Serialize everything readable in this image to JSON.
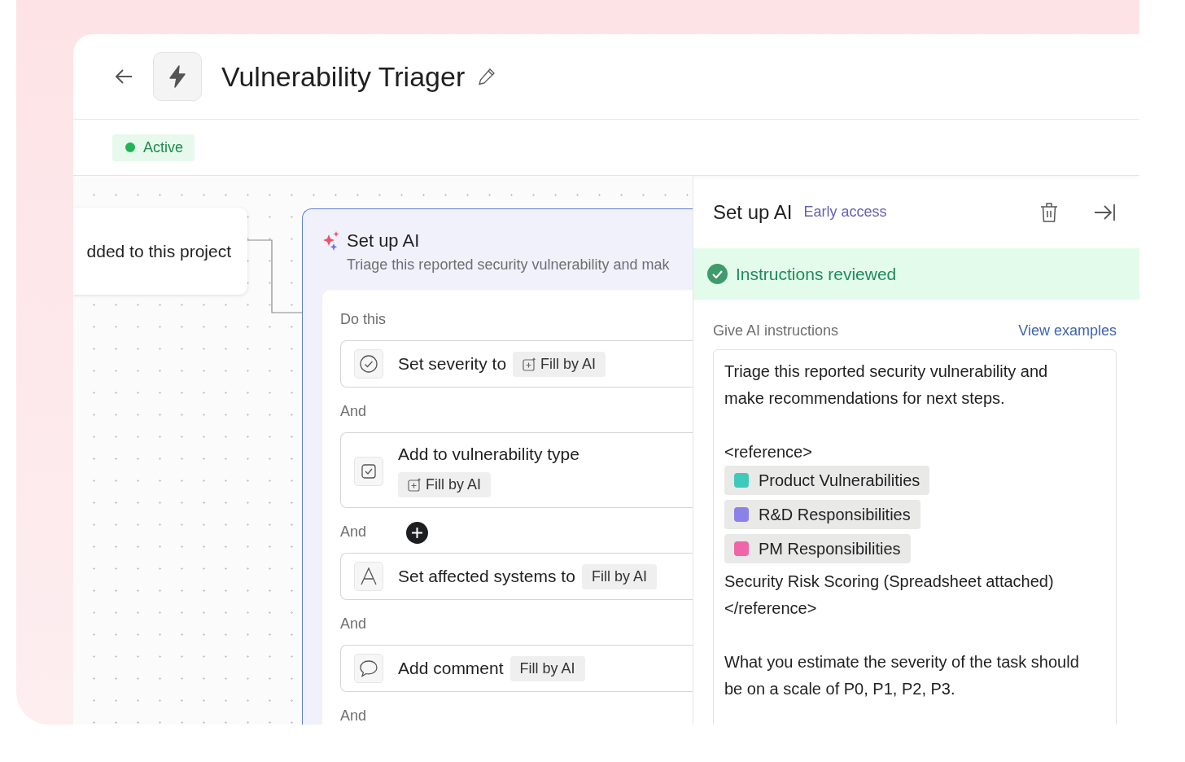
{
  "header": {
    "title": "Vulnerability Triager",
    "status": {
      "label": "Active",
      "color": "#22b455"
    }
  },
  "canvas": {
    "previous_card": {
      "text": "dded to this project"
    },
    "node": {
      "title": "Set up AI",
      "description": "Triage this reported security vulnerability and mak",
      "section_label": "Do this",
      "steps": [
        {
          "kind": "single-select",
          "label": "Set severity to",
          "chip": "Fill by AI",
          "chip_icon": true,
          "chip_below": false,
          "connector": "And"
        },
        {
          "kind": "multi-select",
          "label": "Add to vulnerability type",
          "chip": "Fill by AI",
          "chip_icon": true,
          "chip_below": true,
          "connector": "And"
        },
        {
          "kind": "text",
          "label": "Set affected systems to",
          "chip": "Fill by AI",
          "chip_icon": false,
          "chip_below": false,
          "connector": "And"
        },
        {
          "kind": "comment",
          "label": "Add comment",
          "chip": "Fill by AI",
          "chip_icon": false,
          "chip_below": false,
          "connector": "And"
        }
      ]
    }
  },
  "panel": {
    "title": "Set up AI",
    "badge": "Early access",
    "banner": "Instructions reviewed",
    "field_label": "Give AI instructions",
    "link": "View examples",
    "instructions": [
      {
        "kind": "text",
        "text": "Triage this reported security vulnerability and make recommendations for next steps."
      },
      {
        "kind": "gap"
      },
      {
        "kind": "text",
        "text": "<reference>"
      },
      {
        "kind": "tag",
        "text": "Product Vulnerabilities",
        "color": "#3ec9bd"
      },
      {
        "kind": "tag",
        "text": "R&D Responsibilities",
        "color": "#8a82e8"
      },
      {
        "kind": "tag",
        "text": "PM Responsibilities",
        "color": "#f064a8"
      },
      {
        "kind": "text",
        "text": "Security Risk Scoring (Spreadsheet attached)"
      },
      {
        "kind": "text",
        "text": "</reference>"
      },
      {
        "kind": "gap"
      },
      {
        "kind": "text",
        "text": "What you estimate the severity of the task should be on a scale of P0, P1, P2, P3."
      }
    ]
  }
}
